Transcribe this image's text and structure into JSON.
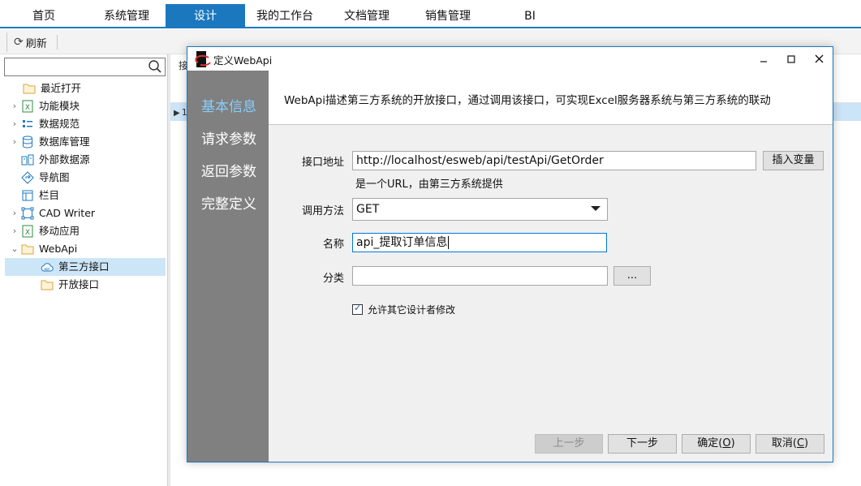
{
  "topnav": {
    "tabs": [
      {
        "label": "首页"
      },
      {
        "label": "系统管理"
      },
      {
        "label": "设计"
      },
      {
        "label": "我的工作台"
      },
      {
        "label": "文档管理"
      },
      {
        "label": "销售管理"
      },
      {
        "label": "BI"
      }
    ],
    "active_index": 2
  },
  "toolbar": {
    "refresh_label": "刷新"
  },
  "search": {
    "placeholder": ""
  },
  "tree": {
    "items": [
      {
        "label": "最近打开",
        "icon": "folder-icon",
        "expandable": false
      },
      {
        "label": "功能模块",
        "icon": "excel-icon",
        "expandable": true
      },
      {
        "label": "数据规范",
        "icon": "list-icon",
        "expandable": true
      },
      {
        "label": "数据库管理",
        "icon": "database-icon",
        "expandable": true
      },
      {
        "label": "外部数据源",
        "icon": "datasource-icon",
        "expandable": false
      },
      {
        "label": "导航图",
        "icon": "navigation-icon",
        "expandable": false
      },
      {
        "label": "栏目",
        "icon": "column-icon",
        "expandable": false
      },
      {
        "label": "CAD Writer",
        "icon": "cad-icon",
        "expandable": true
      },
      {
        "label": "移动应用",
        "icon": "excel-icon",
        "expandable": true
      },
      {
        "label": "WebApi",
        "icon": "folder-icon",
        "expandable": true,
        "expanded": true
      },
      {
        "label": "第三方接口",
        "icon": "cloud-api-icon",
        "expandable": false,
        "selected": true
      },
      {
        "label": "开放接口",
        "icon": "folder-icon",
        "expandable": false
      }
    ]
  },
  "background": {
    "header_fragment": "接",
    "row_fragment": "1"
  },
  "dialog": {
    "title": "定义WebApi",
    "steps": [
      {
        "label": "基本信息",
        "active": true
      },
      {
        "label": "请求参数",
        "active": false
      },
      {
        "label": "返回参数",
        "active": false
      },
      {
        "label": "完整定义",
        "active": false
      }
    ],
    "description": "WebApi描述第三方系统的开放接口，通过调用该接口，可实现Excel服务器系统与第三方系统的联动",
    "fields": {
      "url_label": "接口地址",
      "url_value": "http://localhost/esweb/api/testApi/GetOrder",
      "insert_var_label": "插入变量",
      "url_hint": "是一个URL，由第三方系统提供",
      "method_label": "调用方法",
      "method_value": "GET",
      "name_label": "名称",
      "name_value": "api_提取订单信息",
      "category_label": "分类",
      "category_value": "",
      "browse_label": "...",
      "allow_modify_label": "允许其它设计者修改",
      "allow_modify_checked": true
    },
    "buttons": {
      "prev": {
        "text": "上一步",
        "enabled": false
      },
      "next": {
        "text": "下一步",
        "enabled": true
      },
      "ok": {
        "text": "确定(",
        "key": "O",
        "tail": ")"
      },
      "cancel": {
        "text": "取消(",
        "key": "C",
        "tail": ")"
      }
    }
  }
}
